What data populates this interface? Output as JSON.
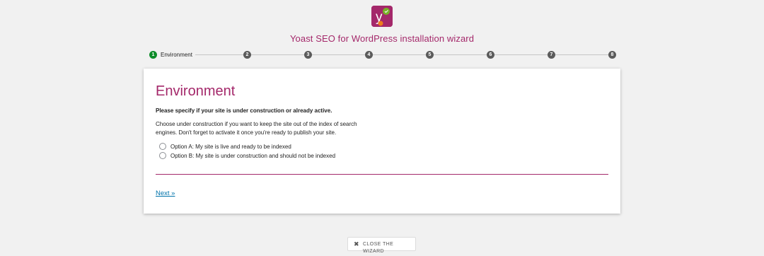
{
  "header": {
    "title": "Yoast SEO for WordPress installation wizard",
    "logo_icon": "yoast-logo-icon",
    "brand_color": "#a4286a"
  },
  "steps": [
    {
      "number": "1",
      "label": "Environment",
      "active": true
    },
    {
      "number": "2"
    },
    {
      "number": "3"
    },
    {
      "number": "4"
    },
    {
      "number": "5"
    },
    {
      "number": "6"
    },
    {
      "number": "7"
    },
    {
      "number": "8"
    }
  ],
  "panel": {
    "heading": "Environment",
    "question": "Please specify if your site is under construction or already active.",
    "description": "Choose under construction if you want to keep the site out of the index of search engines. Don't forget to activate it once you're ready to publish your site.",
    "options": [
      {
        "label": "Option A: My site is live and ready to be indexed",
        "selected": false
      },
      {
        "label": "Option B: My site is under construction and should not be indexed",
        "selected": false
      }
    ],
    "next_label": "Next »"
  },
  "footer": {
    "close_label": "CLOSE THE WIZARD",
    "close_icon": "close-icon"
  },
  "colors": {
    "active_step": "#0e8c2a",
    "inactive_step": "#5b5b5b",
    "link": "#0073aa"
  }
}
